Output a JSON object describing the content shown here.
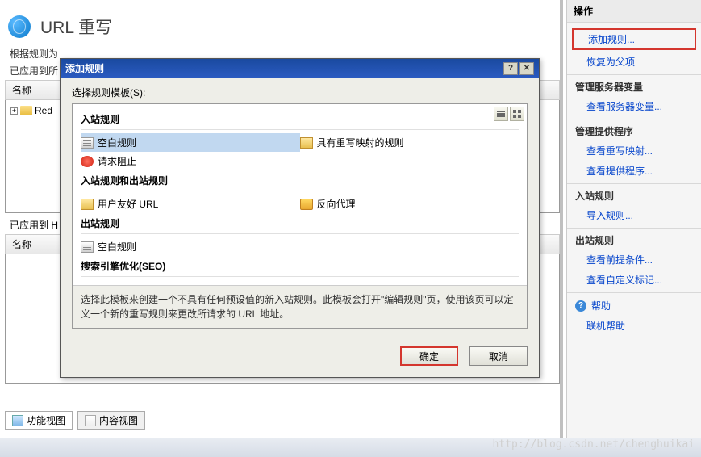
{
  "page": {
    "title": "URL 重写",
    "desc_prefix": "根据规则为",
    "applied_label": "已应用到所",
    "name_header": "名称",
    "tree_item": "Red",
    "applied_h": "已应用到 H",
    "footer_tab_feature": "功能视图",
    "footer_tab_content": "内容视图"
  },
  "actions": {
    "header": "操作",
    "add_rule": "添加规则...",
    "restore_parent": "恢复为父项",
    "section_server_vars": "管理服务器变量",
    "view_server_vars": "查看服务器变量...",
    "section_providers": "管理提供程序",
    "view_rewrite_maps": "查看重写映射...",
    "view_providers": "查看提供程序...",
    "section_inbound": "入站规则",
    "import_rules": "导入规则...",
    "section_outbound": "出站规则",
    "view_preconditions": "查看前提条件...",
    "view_custom_tags": "查看自定义标记...",
    "help": "帮助",
    "online_help": "联机帮助"
  },
  "dialog": {
    "title": "添加规则",
    "template_label": "选择规则模板(S):",
    "sections": {
      "inbound": "入站规则",
      "both": "入站规则和出站规则",
      "outbound": "出站规则",
      "seo": "搜索引擎优化(SEO)"
    },
    "rules": {
      "blank": "空白规则",
      "with_map": "具有重写映射的规则",
      "request_block": "请求阻止",
      "friendly_url": "用户友好 URL",
      "reverse_proxy": "反向代理",
      "blank_out": "空白规则"
    },
    "description": "选择此模板来创建一个不具有任何预设值的新入站规则。此模板会打开\"编辑规则\"页，使用该页可以定义一个新的重写规则来更改所请求的 URL 地址。",
    "ok": "确定",
    "cancel": "取消"
  },
  "watermark": "http://blog.csdn.net/chenghuikai"
}
